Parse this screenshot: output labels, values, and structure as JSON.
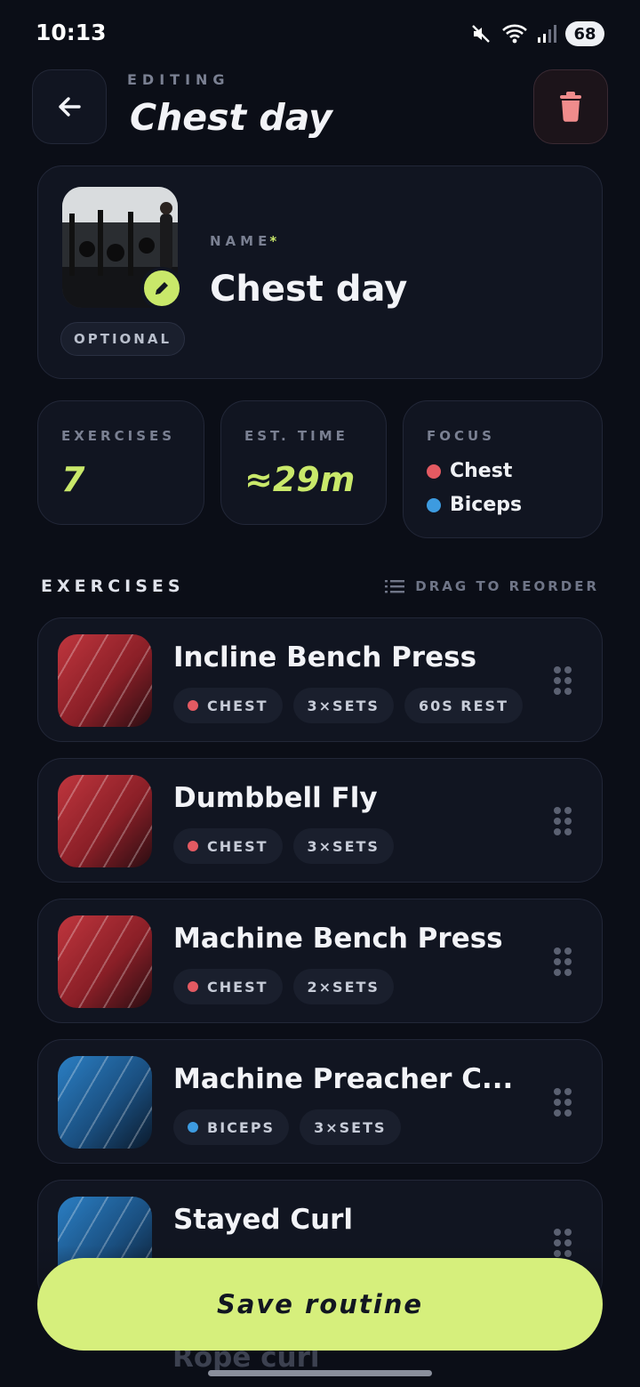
{
  "status_bar": {
    "time": "10:13",
    "battery": "68",
    "icons": [
      "mute-icon",
      "wifi-icon",
      "signal-icon"
    ]
  },
  "header": {
    "kicker": "EDITING",
    "title": "Chest day",
    "back_icon": "arrow-left-icon",
    "delete_icon": "trash-icon"
  },
  "name_card": {
    "optional_label": "OPTIONAL",
    "name_label": "NAME",
    "required_marker": "*",
    "name_value": "Chest day",
    "edit_icon": "pencil-icon"
  },
  "stats": {
    "exercises": {
      "label": "EXERCISES",
      "value": "7"
    },
    "est_time": {
      "label": "EST. TIME",
      "value": "≈29m"
    },
    "focus": {
      "label": "FOCUS",
      "items": [
        {
          "name": "Chest",
          "color": "#e35a62"
        },
        {
          "name": "Biceps",
          "color": "#3d9be0"
        }
      ]
    }
  },
  "section": {
    "title": "EXERCISES",
    "drag_hint": "DRAG TO REORDER"
  },
  "exercises": [
    {
      "name": "Incline Bench Press",
      "muscle": "CHEST",
      "sets": "3×SETS",
      "rest": "60S REST"
    },
    {
      "name": "Dumbbell Fly",
      "muscle": "CHEST",
      "sets": "3×SETS"
    },
    {
      "name": "Machine Bench Press",
      "muscle": "CHEST",
      "sets": "2×SETS"
    },
    {
      "name": "Machine Preacher C...",
      "muscle": "BICEPS",
      "sets": "3×SETS"
    },
    {
      "name": "Stayed Curl"
    },
    {
      "name": "Rope curl"
    }
  ],
  "colors": {
    "accent": "#c9e86a",
    "chest": "#e35a62",
    "biceps": "#3d9be0",
    "background": "#0b0e17"
  },
  "save_button": "Save routine"
}
